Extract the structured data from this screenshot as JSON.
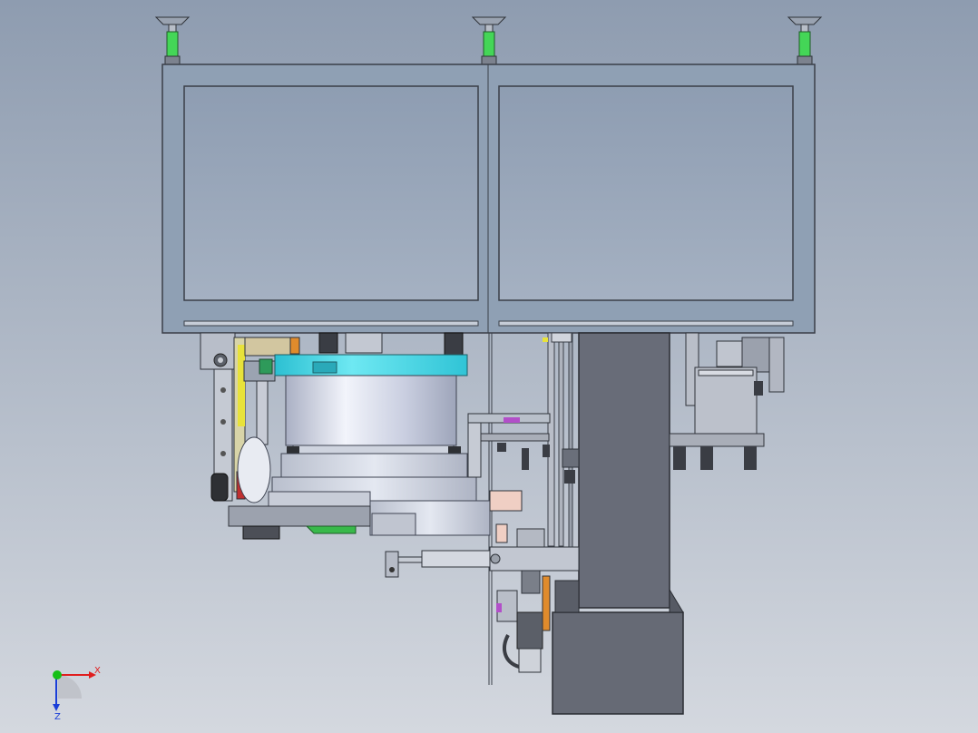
{
  "viewport": {
    "background_top": "#8e9cb0",
    "background_bottom": "#d4d8df"
  },
  "colors": {
    "frame": "#8fa0b4",
    "frame_edge": "#3a3f48",
    "column": "#686c78",
    "base_block": "#666a75",
    "cyan_ring": "#49d6e4",
    "cylinder_light": "#e9ecf6",
    "cylinder_dark": "#b3b9cc",
    "green_post": "#44d657",
    "green_plate": "#38b94a",
    "yellow_strip": "#e8e23a",
    "orange_part": "#e08b2c",
    "purple_part": "#b24fc9",
    "pink_part": "#f0cfc4",
    "red_part": "#c03030",
    "steel_light": "#d5d9e0",
    "steel_mid": "#a9aeb8",
    "steel_dark": "#45484f"
  },
  "triad": {
    "x_label": "X",
    "z_label": "Z",
    "x_color": "#e01e1e",
    "y_color": "#16c016",
    "z_color": "#1a3ed8"
  }
}
